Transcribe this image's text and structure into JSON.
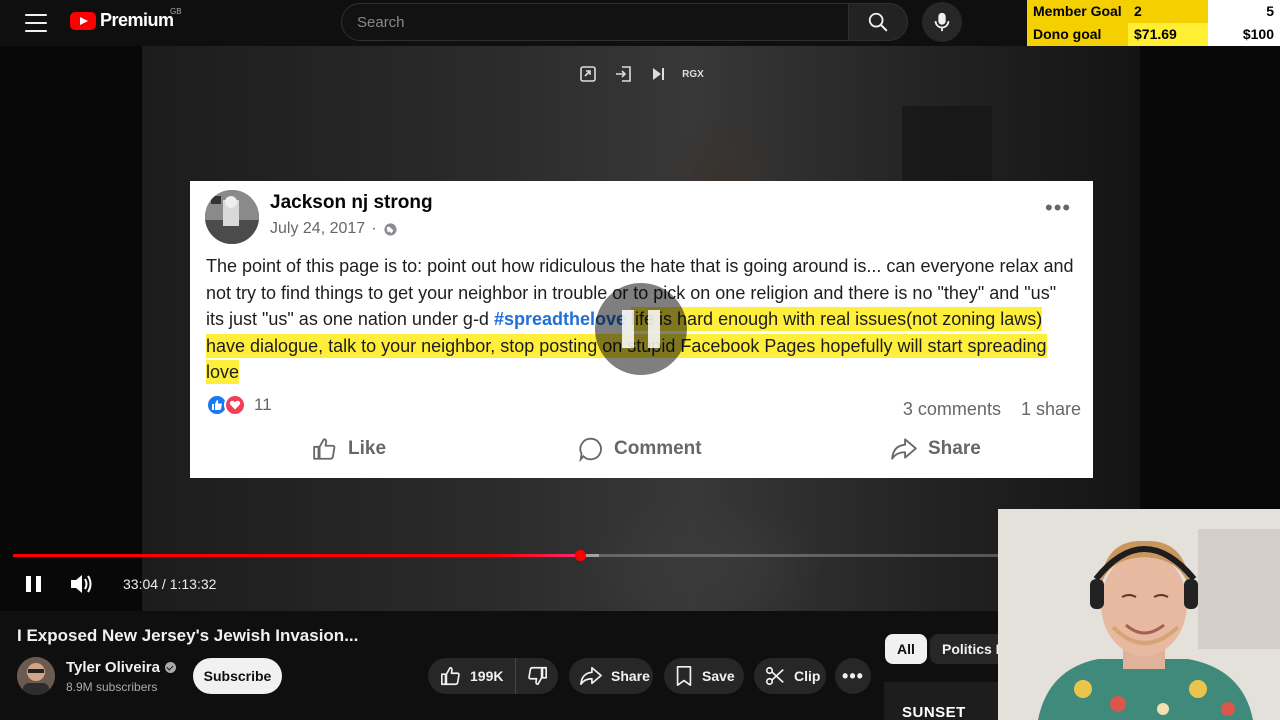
{
  "header": {
    "logo_text": "Premium",
    "region": "GB",
    "search_placeholder": "Search"
  },
  "goals": {
    "member": {
      "label": "Member Goal",
      "current": "2",
      "target": "5"
    },
    "dono": {
      "label": "Dono goal",
      "current": "$71.69",
      "target": "$100"
    }
  },
  "player": {
    "top_tools": [
      "miniplayer-icon",
      "theater-exit-icon",
      "next-icon",
      "RGX"
    ],
    "time_current": "33:04",
    "time_sep": " / ",
    "time_total": "1:13:32",
    "progress_played": 0.575,
    "progress_loaded": 0.594
  },
  "post": {
    "author": "Jackson nj strong",
    "date": "July 24, 2017",
    "text_plain": "The point of this page is to: point out how ridiculous the hate that is going around is... can everyone relax and not try to find things to get your neighbor in trouble or to pick on one religion and there is no \"they\" and \"us\" its just \"us\" as one nation under g-d ",
    "hashtag": "#spreadthelove",
    "text_highlighted": "life is hard enough with real issues(not zoning laws) have dialogue, talk to your neighbor, stop posting on stupid Facebook Pages hopefully will start spreading love",
    "reaction_count": "11",
    "comments": "3 comments",
    "shares": "1 share",
    "actions": {
      "like": "Like",
      "comment": "Comment",
      "share": "Share"
    }
  },
  "video": {
    "title": "I Exposed New Jersey's Jewish Invasion...",
    "channel": "Tyler Oliveira",
    "subscribers": "8.9M subscribers",
    "subscribe_label": "Subscribe",
    "likes": "199K",
    "share_label": "Share",
    "save_label": "Save",
    "clip_label": "Clip",
    "more_label": "•••"
  },
  "chips": {
    "all": "All",
    "politics": "Politics N"
  },
  "thumbnail": {
    "text": "SUNSET"
  },
  "colors": {
    "accent": "#ff0000",
    "goal_yellow": "#f5d000",
    "highlight": "#ffef3a",
    "hashtag": "#216fdb"
  }
}
